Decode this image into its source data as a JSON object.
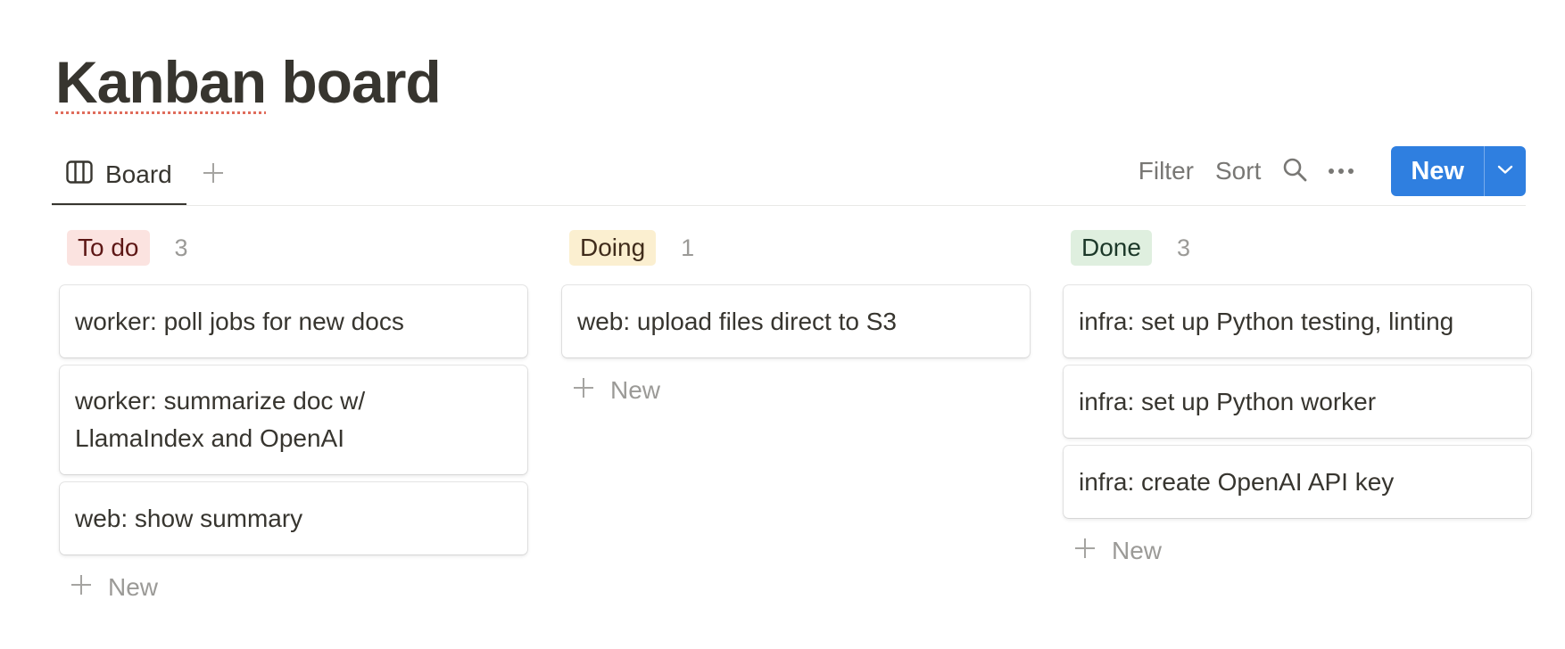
{
  "page": {
    "title_misspelled": "Kanban",
    "title_rest": " board"
  },
  "toolbar": {
    "view_tab_label": "Board",
    "view_tab_icon": "board-view-icon",
    "add_view_icon": "plus-icon",
    "filter_label": "Filter",
    "sort_label": "Sort",
    "search_icon": "search-icon",
    "more_icon": "more-horizontal-icon",
    "new_label": "New",
    "new_dropdown_icon": "chevron-down-icon"
  },
  "colors": {
    "accent_blue": "#2f7fe0",
    "todo_bg": "#fbe3e0",
    "todo_text": "#5d1715",
    "doing_bg": "#fbefd0",
    "doing_text": "#402c1b",
    "done_bg": "#dfefdf",
    "done_text": "#1c3829"
  },
  "columns": [
    {
      "status": "To do",
      "count": "3",
      "cards": [
        "worker: poll jobs for new docs",
        "worker: summarize doc w/ LlamaIndex and OpenAI",
        "web: show summary"
      ],
      "new_label": "New"
    },
    {
      "status": "Doing",
      "count": "1",
      "cards": [
        "web: upload files direct to S3"
      ],
      "new_label": "New"
    },
    {
      "status": "Done",
      "count": "3",
      "cards": [
        "infra: set up Python testing, linting",
        "infra: set up Python worker",
        "infra: create OpenAI API key"
      ],
      "new_label": "New"
    }
  ]
}
